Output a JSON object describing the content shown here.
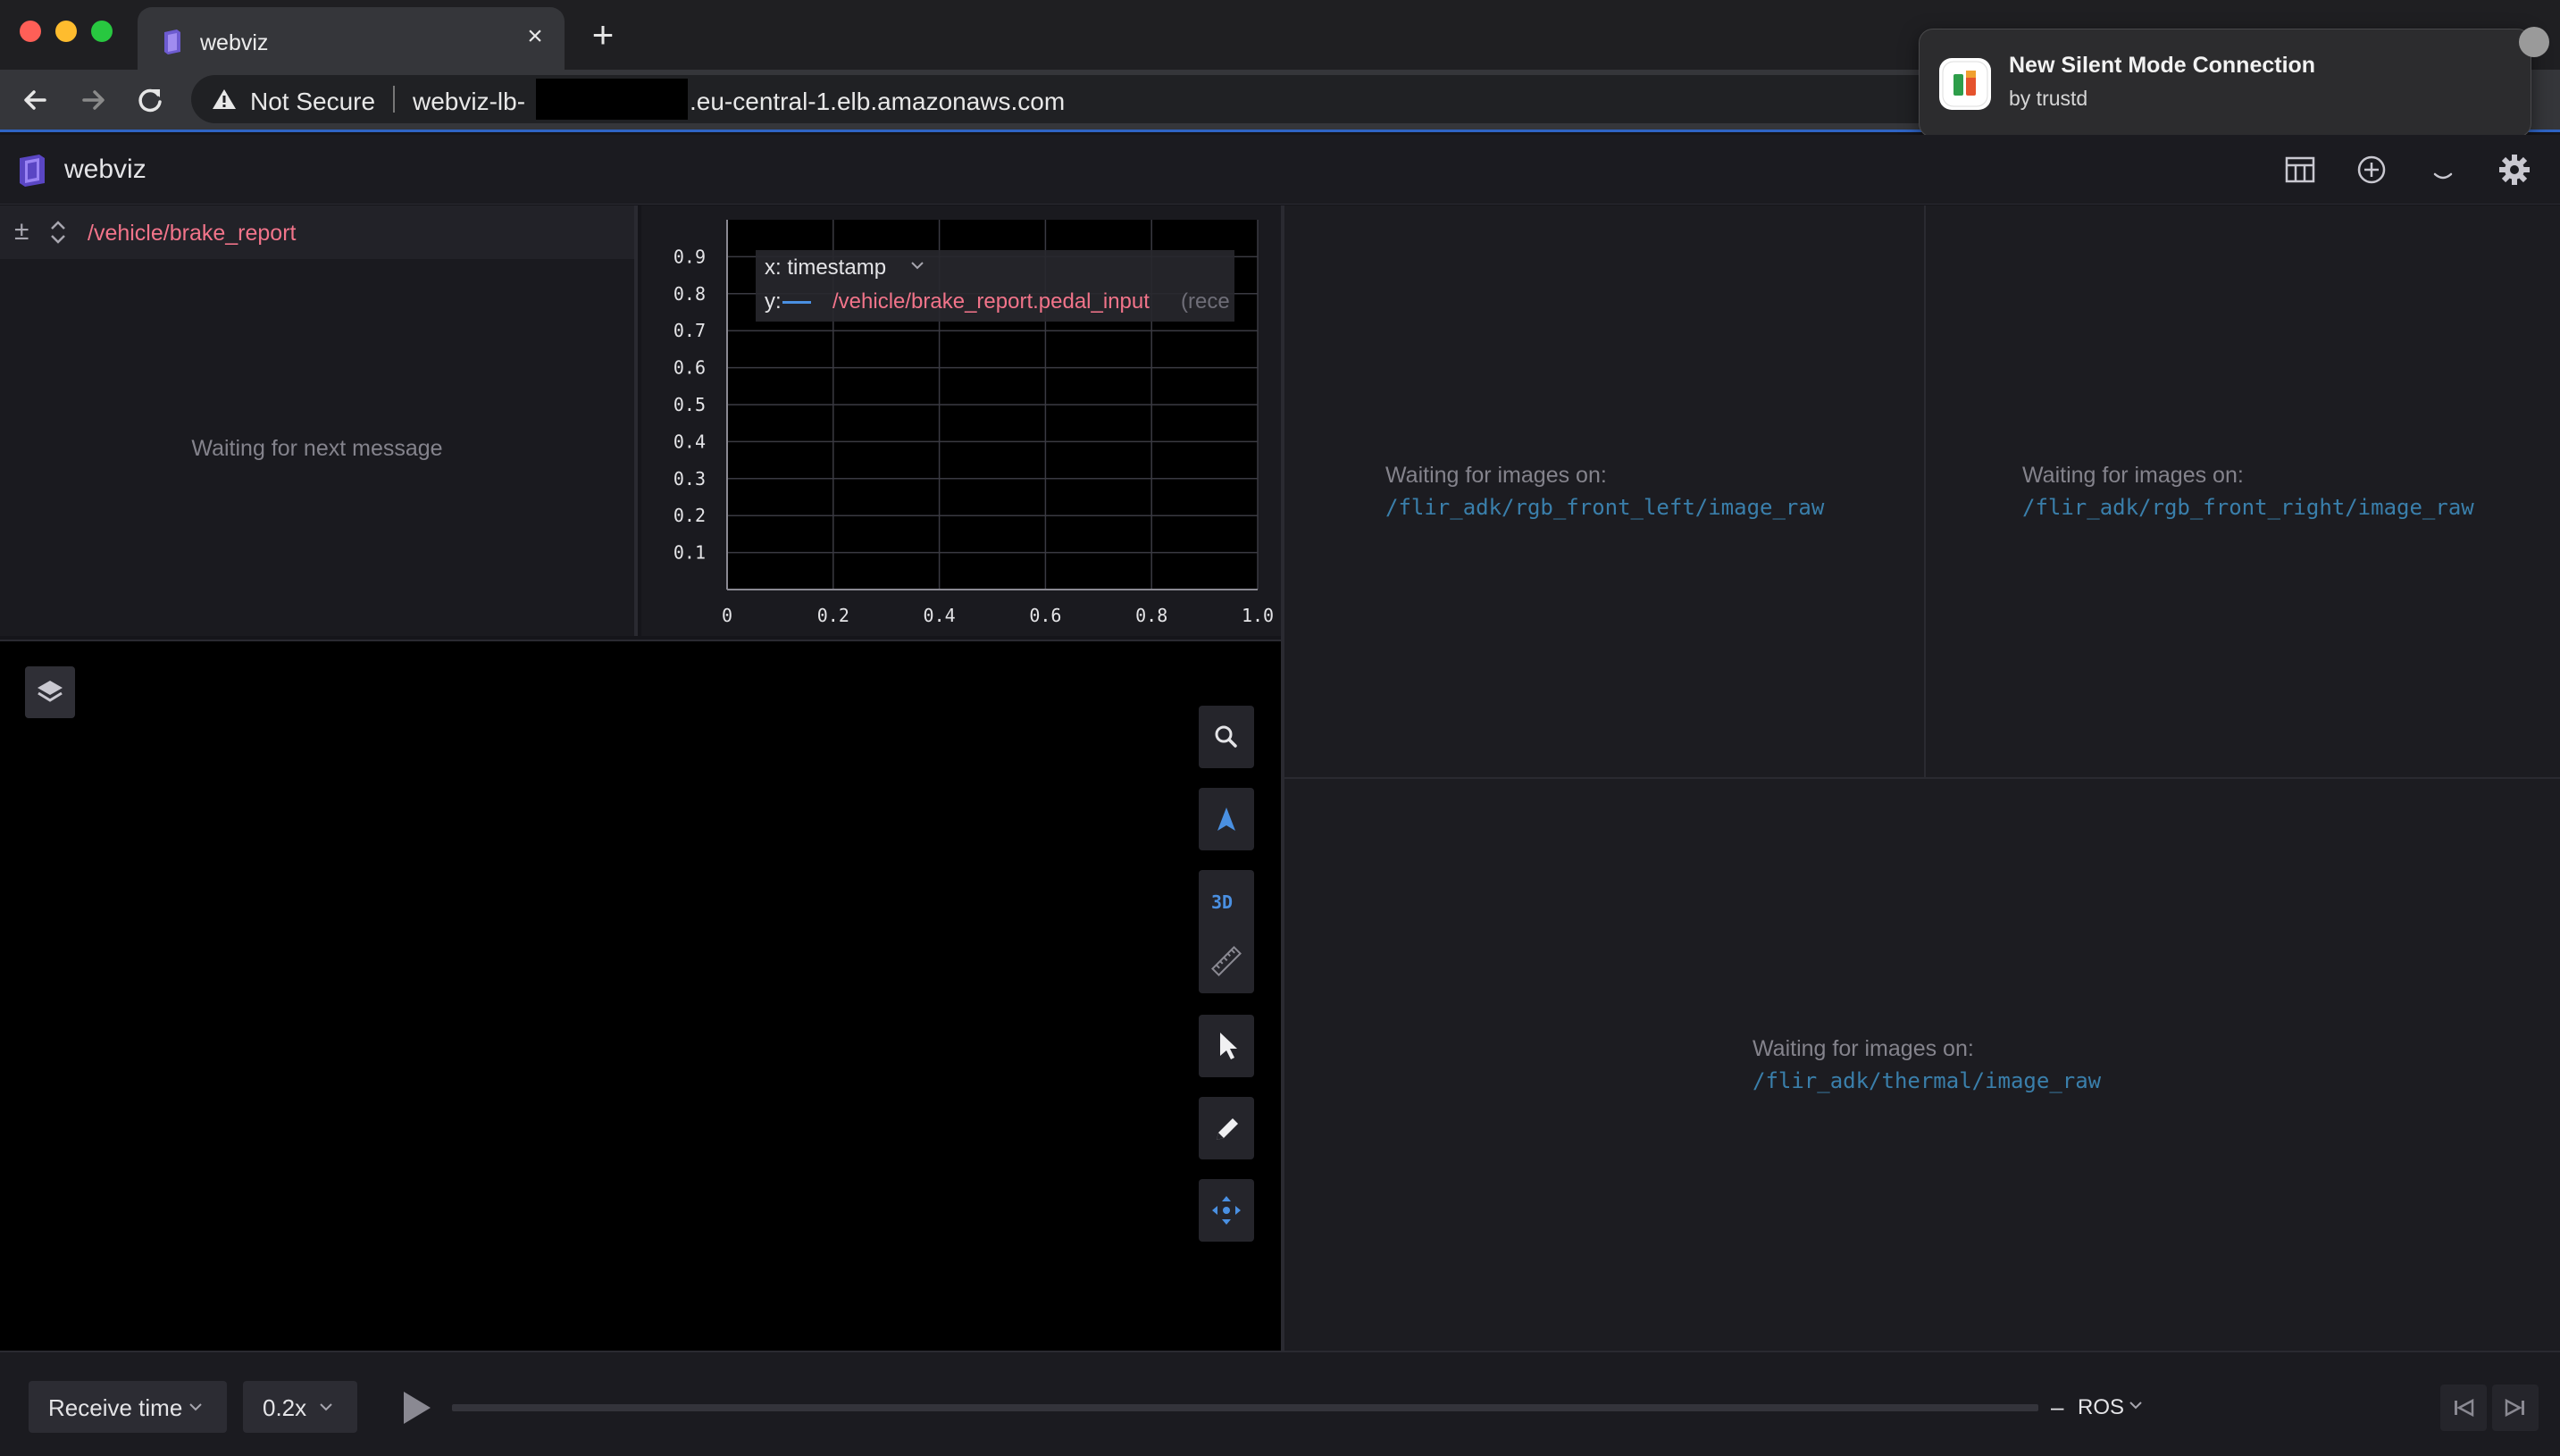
{
  "browser": {
    "tab_title": "webviz",
    "tab_close": "×",
    "new_tab": "+",
    "security_label": "Not Secure",
    "url_prefix": "webviz-lb-",
    "url_suffix": ".eu-central-1.elb.amazonaws.com",
    "accent_color": "#2f64c4"
  },
  "notification": {
    "title": "New Silent Mode Connection",
    "subtitle": "by trustd"
  },
  "app": {
    "title": "webviz",
    "toolbar_icons": [
      "layout-icon",
      "add-panel-icon",
      "help-icon",
      "settings-icon"
    ],
    "accent_color": "#8b5cf6"
  },
  "raw_panel": {
    "controls": "±",
    "topic": "/vehicle/brake_report",
    "waiting": "Waiting for next message"
  },
  "plot_panel": {
    "legend_x_prefix": "x:",
    "legend_x_value": "timestamp",
    "legend_y_prefix": "y:",
    "legend_y_path": "/vehicle/brake_report.pedal_input",
    "legend_y_suffix": "(rece"
  },
  "chart_data": {
    "type": "line",
    "series": [
      {
        "name": "/vehicle/brake_report.pedal_input",
        "values": []
      }
    ],
    "x_ticks": [
      "0",
      "0.2",
      "0.4",
      "0.6",
      "0.8",
      "1.0"
    ],
    "y_ticks": [
      "0.9",
      "0.8",
      "0.7",
      "0.6",
      "0.5",
      "0.4",
      "0.3",
      "0.2",
      "0.1"
    ],
    "xlim": [
      0,
      1
    ],
    "ylim": [
      0,
      1
    ],
    "grid": true
  },
  "image_panels": {
    "waiting_label": "Waiting for images on:",
    "front_left": "/flir_adk/rgb_front_left/image_raw",
    "front_right": "/flir_adk/rgb_front_right/image_raw",
    "thermal": "/flir_adk/thermal/image_raw"
  },
  "three_d": {
    "mode_label": "3D"
  },
  "playback": {
    "time_mode": "Receive time",
    "speed": "0.2x",
    "source_dash": "–",
    "source": "ROS"
  }
}
